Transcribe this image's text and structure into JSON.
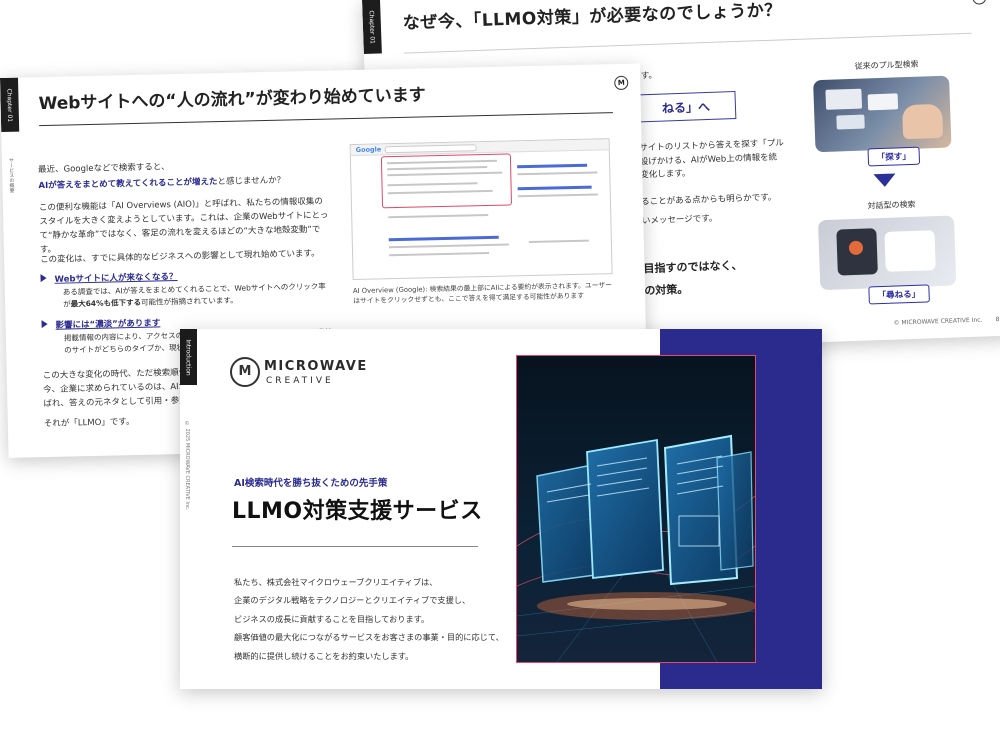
{
  "slide_b": {
    "chapter": "Chapter 01",
    "title": "なぜ今、「LLMO対策」が必要なのでしょうか？",
    "text_top": "す。",
    "pill_text": "ねる」へ",
    "para1": [
      "サイトのリストから答えを探す「プル",
      "設げかける、AIがWeb上の情報を統",
      "変化します。"
    ],
    "para2": [
      "ることがある点からも明らかです。",
      "いメッセージです。"
    ],
    "bold1": "目指すのではなく、",
    "bold2": "の対策。",
    "label_pull": "従来のプル型検索",
    "tag_search": "「探す」",
    "label_dialog": "対話型の検索",
    "tag_ask": "「尋ねる」",
    "footer": "© MICROWAVE CREATIVE Inc.",
    "page_no": "8"
  },
  "slide_a": {
    "chapter": "Chapter 01",
    "title": "Webサイトへの“人の流れ”が変わり始めています",
    "side_note": "サービスの概要",
    "p1": "最近、Googleなどで検索すると、",
    "p1_blue": "AIが答えをまとめて教えてくれることが増えた",
    "p1_tail": "と感じませんか？",
    "p2": "この便利な機能は「AI Overviews (AIO)」と呼ばれ、私たちの情報収集のスタイルを大きく変えようとしています。これは、企業のWebサイトにとって“静かな革命”ではなく、客足の流れを変えるほどの“大きな地殻変動”です。",
    "p3": "この変化は、すでに具体的なビジネスへの影響として現れ始めています。",
    "bullet1": "Webサイトに人が来なくなる？",
    "bullet1_text_a": "ある調査では、AIが答えをまとめてくれることで、Webサイトへのクリック率が",
    "bullet1_bold": "最大64%も低下する",
    "bullet1_text_b": "可能性が指摘されています。",
    "bullet2": "影響には“濃淡”があります",
    "bullet2_text": "掲載情報の内容により、アクセスの減少・増加の傾向に違いが見られます。貴社のサイトがどちらのタイプか、現状を正確に把",
    "p4": [
      "この大きな変化の時代、ただ検索順位を",
      "今、企業に求められているのは、AIから",
      "ばれ、答えの元ネタとして引用・参照さ"
    ],
    "p5": "それが「LLMO」です。",
    "google_logo": "Google",
    "caption": "AI Overview (Google): 検索結果の最上部にAIによる要約が表示されます。ユーザーはサイトをクリックせずとも、ここで答えを得て満足する可能性があります"
  },
  "slide_c": {
    "strip": "Introduction",
    "side_note": "© 2025 MICROWAVE CREATIVE Inc.",
    "logo_mark": "M",
    "brand_line1": "MICROWAVE",
    "brand_line2": "CREATIVE",
    "subtitle": "AI検索時代を勝ち抜くための先手策",
    "title": "LLMO対策支援サービス",
    "body": [
      "私たち、株式会社マイクロウェーブクリエイティブは、",
      "企業のデジタル戦略をテクノロジーとクリエイティブで支援し、",
      "ビジネスの成長に貢献することを目指しております。",
      "顧客価値の最大化につながるサービスをお客さまの事業・目的に応じて、",
      "横断的に提供し続けることをお約束いたします。"
    ],
    "colors": {
      "navy": "#2b2b8e",
      "accent_blue": "#2b2b90"
    }
  }
}
